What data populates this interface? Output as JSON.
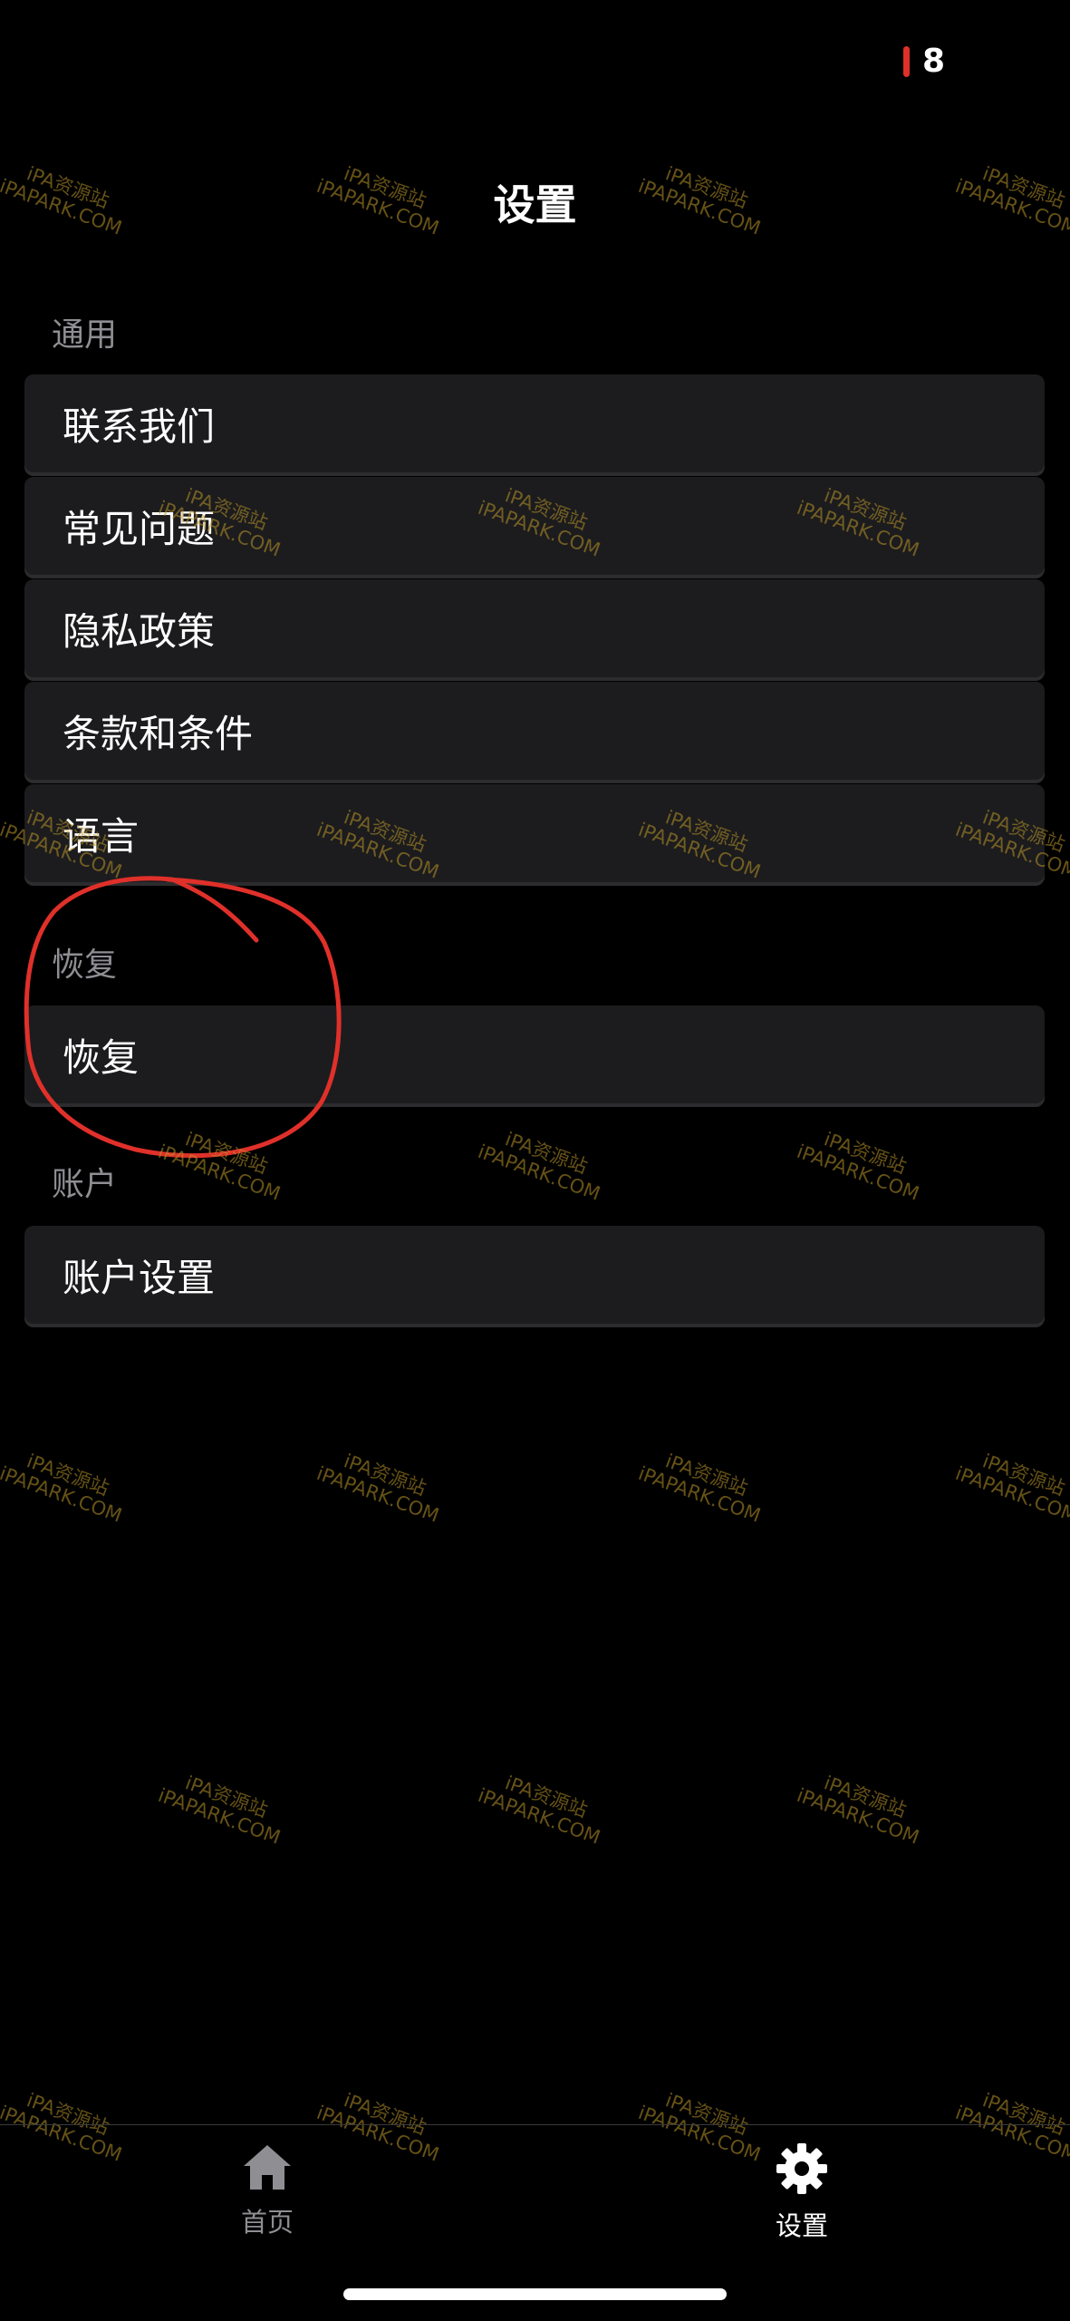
{
  "status": {
    "count": "8"
  },
  "page_title": "设置",
  "sections": [
    {
      "label": "通用",
      "items": [
        "联系我们",
        "常见问题",
        "隐私政策",
        "条款和条件",
        "语言"
      ]
    },
    {
      "label": "恢复",
      "items": [
        "恢复"
      ]
    },
    {
      "label": "账户",
      "items": [
        "账户设置"
      ]
    }
  ],
  "tabbar": {
    "home_label": "首页",
    "home_icon": "house-icon",
    "settings_label": "设置",
    "settings_icon": "gear-icon"
  },
  "watermark": {
    "line1": "iPA资源站",
    "line2": "iPAPARK.COM"
  },
  "colors": {
    "background": "#000000",
    "row_bg": "#1c1c1e",
    "section_label": "#8e8e93",
    "tab_inactive": "#8e8e93",
    "tab_active": "#ffffff",
    "annotation_red": "#e0302a"
  }
}
